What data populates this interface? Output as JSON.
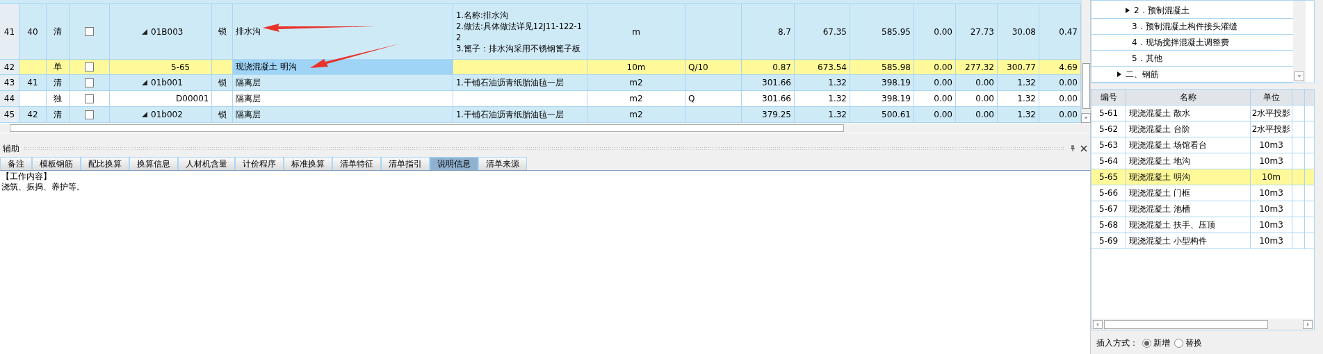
{
  "main_table": {
    "rows": [
      {
        "row_no": "41",
        "seq": "40",
        "type": "清",
        "kind": "bill",
        "checked": false,
        "expanded": true,
        "code": "01B003",
        "lock": "锁",
        "name": "排水沟",
        "feature": "1.名称:排水沟\n2.做法:具体做法详见12J11-122-12\n3.篦子：排水沟采用不锈钢篦子板",
        "unit": "m",
        "expr": "",
        "amounts": [
          "8.7",
          "67.35",
          "585.95",
          "0.00",
          "27.73",
          "30.08",
          "0.47"
        ],
        "selected": false
      },
      {
        "row_no": "42",
        "seq": "",
        "type": "单",
        "kind": "quota",
        "checked": false,
        "code": "5-65",
        "lock": "",
        "name": "现浇混凝土 明沟",
        "feature": "",
        "unit": "10m",
        "expr": "Q/10",
        "amounts": [
          "0.87",
          "673.54",
          "585.98",
          "0.00",
          "277.32",
          "300.77",
          "4.69"
        ],
        "selected": true
      },
      {
        "row_no": "43",
        "seq": "41",
        "type": "清",
        "kind": "bill",
        "checked": false,
        "expanded": true,
        "code": "01b001",
        "lock": "锁",
        "name": "隔离层",
        "feature": "1.干铺石油沥青纸胎油毡一层",
        "unit": "m2",
        "expr": "",
        "amounts": [
          "301.66",
          "1.32",
          "398.19",
          "0.00",
          "0.00",
          "1.32",
          "0.00"
        ],
        "selected": false
      },
      {
        "row_no": "44",
        "seq": "",
        "type": "独",
        "kind": "sub",
        "checked": false,
        "code": "D00001",
        "lock": "",
        "name": "隔离层",
        "feature": "",
        "unit": "m2",
        "expr": "Q",
        "amounts": [
          "301.66",
          "1.32",
          "398.19",
          "0.00",
          "0.00",
          "1.32",
          "0.00"
        ],
        "selected": false
      },
      {
        "row_no": "45",
        "seq": "42",
        "type": "清",
        "kind": "bill",
        "checked": false,
        "expanded": true,
        "code": "01b002",
        "lock": "锁",
        "name": "隔离层",
        "feature": "1.干铺石油沥青纸胎油毡一层",
        "unit": "m2",
        "expr": "",
        "amounts": [
          "379.25",
          "1.32",
          "500.61",
          "0.00",
          "0.00",
          "1.32",
          "0.00"
        ],
        "selected": false
      }
    ]
  },
  "aux_panel": {
    "title": "辅助",
    "tabs": [
      {
        "label": "备注",
        "selected": false
      },
      {
        "label": "模板钢筋",
        "selected": false
      },
      {
        "label": "配比换算",
        "selected": false
      },
      {
        "label": "换算信息",
        "selected": false
      },
      {
        "label": "人材机含量",
        "selected": false
      },
      {
        "label": "计价程序",
        "selected": false
      },
      {
        "label": "标准换算",
        "selected": false
      },
      {
        "label": "清单特征",
        "selected": false
      },
      {
        "label": "清单指引",
        "selected": false
      },
      {
        "label": "说明信息",
        "selected": true
      },
      {
        "label": "清单来源",
        "selected": false
      }
    ],
    "content": [
      "【工作内容】",
      "浇筑、振捣、养护等。"
    ]
  },
  "tree": [
    {
      "children": [
        {
          "label": "2．预制混凝土",
          "expanded": false
        },
        {
          "label": "3．预制混凝土构件接头灌缝"
        },
        {
          "label": "4．现场搅拌混凝土调整费"
        },
        {
          "label": "5．其他"
        }
      ]
    },
    {
      "label": "二、钢筋",
      "expanded": false
    }
  ],
  "quota_list": {
    "columns": [
      "编号",
      "名称",
      "单位"
    ],
    "rows": [
      {
        "code": "5-61",
        "name": "现浇混凝土 散水",
        "unit": "2水平投影",
        "selected": false
      },
      {
        "code": "5-62",
        "name": "现浇混凝土 台阶",
        "unit": "2水平投影",
        "selected": false
      },
      {
        "code": "5-63",
        "name": "现浇混凝土 场馆看台",
        "unit": "10m3",
        "selected": false
      },
      {
        "code": "5-64",
        "name": "现浇混凝土 地沟",
        "unit": "10m3",
        "selected": false
      },
      {
        "code": "5-65",
        "name": "现浇混凝土 明沟",
        "unit": "10m",
        "selected": true
      },
      {
        "code": "5-66",
        "name": "现浇混凝土 门框",
        "unit": "10m3",
        "selected": false
      },
      {
        "code": "5-67",
        "name": "现浇混凝土 池槽",
        "unit": "10m3",
        "selected": false
      },
      {
        "code": "5-68",
        "name": "现浇混凝土 扶手、压顶",
        "unit": "10m3",
        "selected": false
      },
      {
        "code": "5-69",
        "name": "现浇混凝土 小型构件",
        "unit": "10m3",
        "selected": false
      }
    ]
  },
  "insert_mode": {
    "label": "插入方式：",
    "options": [
      {
        "label": "新增",
        "selected": true
      },
      {
        "label": "替换",
        "selected": false
      }
    ]
  }
}
